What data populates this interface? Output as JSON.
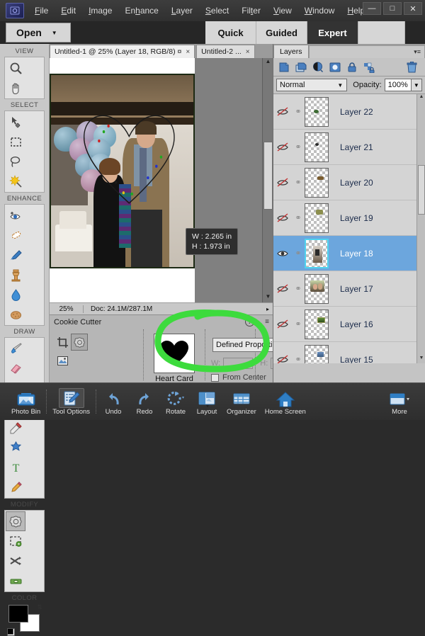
{
  "app": {
    "logo_icon": "photoshop-elements-logo-icon",
    "menu": [
      {
        "label": "File",
        "accel": "F"
      },
      {
        "label": "Edit",
        "accel": "E"
      },
      {
        "label": "Image",
        "accel": "I"
      },
      {
        "label": "Enhance",
        "accel": "h"
      },
      {
        "label": "Layer",
        "accel": "L"
      },
      {
        "label": "Select",
        "accel": "S"
      },
      {
        "label": "Filter",
        "accel": "t"
      },
      {
        "label": "View",
        "accel": "V"
      },
      {
        "label": "Window",
        "accel": "W"
      },
      {
        "label": "Help",
        "accel": "H"
      }
    ],
    "window_controls": [
      {
        "name": "minimize",
        "glyph": "—"
      },
      {
        "name": "maximize",
        "glyph": "□"
      },
      {
        "name": "close",
        "glyph": "✕"
      }
    ]
  },
  "modebar": {
    "open_label": "Open",
    "open_caret": "▼",
    "tabs": [
      {
        "label": "Quick",
        "active": false
      },
      {
        "label": "Guided",
        "active": false
      },
      {
        "label": "Expert",
        "active": true
      }
    ]
  },
  "toolbox": {
    "groups": [
      {
        "title": "VIEW",
        "tools": [
          {
            "name": "zoom-tool",
            "icon": "magnifier-icon",
            "selected": false
          },
          {
            "name": "hand-tool",
            "icon": "hand-icon",
            "selected": false
          }
        ]
      },
      {
        "title": "SELECT",
        "tools": [
          {
            "name": "move-tool",
            "icon": "move-arrow-icon",
            "selected": false
          },
          {
            "name": "marquee-tool",
            "icon": "rectangular-marquee-icon",
            "selected": false
          },
          {
            "name": "lasso-tool",
            "icon": "lasso-icon",
            "selected": false
          },
          {
            "name": "quick-selection-tool",
            "icon": "magic-wand-icon",
            "selected": false
          }
        ]
      },
      {
        "title": "ENHANCE",
        "tools": [
          {
            "name": "red-eye-tool",
            "icon": "eye-plus-icon",
            "selected": false
          },
          {
            "name": "spot-healing-tool",
            "icon": "healing-bandage-icon",
            "selected": false
          },
          {
            "name": "smart-brush-tool",
            "icon": "smart-brush-icon",
            "selected": false
          },
          {
            "name": "clone-stamp-tool",
            "icon": "clone-stamp-icon",
            "selected": false
          },
          {
            "name": "blur-tool",
            "icon": "water-drop-icon",
            "selected": false
          },
          {
            "name": "sponge-tool",
            "icon": "sponge-icon",
            "selected": false
          }
        ]
      },
      {
        "title": "DRAW",
        "tools": [
          {
            "name": "brush-tool",
            "icon": "paintbrush-icon",
            "selected": false
          },
          {
            "name": "eraser-tool",
            "icon": "eraser-icon",
            "selected": false
          },
          {
            "name": "paint-bucket-tool",
            "icon": "paint-bucket-icon",
            "selected": false
          },
          {
            "name": "gradient-tool",
            "icon": "gradient-icon",
            "selected": false
          },
          {
            "name": "color-picker-tool",
            "icon": "eyedropper-icon",
            "selected": false
          },
          {
            "name": "custom-shape-tool",
            "icon": "blue-shape-icon",
            "selected": false
          },
          {
            "name": "type-tool",
            "icon": "letter-t-icon",
            "selected": false
          },
          {
            "name": "pencil-tool",
            "icon": "pencil-icon",
            "selected": false
          }
        ]
      },
      {
        "title": "MODIFY",
        "tools": [
          {
            "name": "cookie-cutter-tool",
            "icon": "flower-cookie-cutter-icon",
            "selected": true
          },
          {
            "name": "recompose-tool",
            "icon": "recompose-icon",
            "selected": false
          },
          {
            "name": "content-aware-move-tool",
            "icon": "scissors-move-icon",
            "selected": false
          },
          {
            "name": "straighten-tool",
            "icon": "straighten-level-icon",
            "selected": false
          }
        ]
      },
      {
        "title": "COLOR",
        "tools": []
      }
    ],
    "color": {
      "foreground": "#000000",
      "background": "#ffffff",
      "swap_icon": "swap-colors-icon",
      "default_icon": "default-colors-icon"
    }
  },
  "document_tabs": [
    {
      "label": "Untitled-1 @ 25% (Layer 18, RGB/8) ¤",
      "active": true,
      "close": "×"
    },
    {
      "label": "Untitled-2 ...",
      "active": false,
      "close": "×"
    }
  ],
  "canvas": {
    "tooltip": {
      "width_line": "W : 2.265 in",
      "height_line": "H : 1.973 in"
    },
    "selection_shape": "heart-cookie-cutter-outline",
    "photo_description": "wedding photo of couple with balloons and cake"
  },
  "statusbar": {
    "zoom": "25%",
    "doc": "Doc: 24.1M/287.1M",
    "more_caret": "▸"
  },
  "tool_options": {
    "title": "Cookie Cutter",
    "help_glyph": "?",
    "panel_menu_glyph": "≡",
    "mini_tools": [
      {
        "name": "crop-tool",
        "icon": "crop-icon",
        "selected": false
      },
      {
        "name": "cookie-cutter-tool",
        "icon": "flower-cookie-cutter-icon",
        "selected": true
      },
      {
        "name": "photo-merge-tool",
        "icon": "photo-frame-icon",
        "selected": false
      }
    ],
    "shape": {
      "name": "Heart Card",
      "icon": "heart-icon"
    },
    "crop_mode": {
      "value": "Defined Proportions",
      "caret": "▼"
    },
    "width_label": "W:",
    "width_value": "",
    "height_label": "H:",
    "height_value": "",
    "from_center_label": "From Center",
    "from_center_checked": false
  },
  "annotation": {
    "shape": "green-ellipse-highlight",
    "color": "#3ddb3d"
  },
  "layers_panel": {
    "tab_label": "Layers",
    "panel_menu_glyph": "▾≡",
    "tools": [
      {
        "name": "new-layer-button",
        "icon": "new-layer-icon"
      },
      {
        "name": "duplicate-layer-button",
        "icon": "duplicate-layer-icon"
      },
      {
        "name": "adjustment-layer-button",
        "icon": "adjustment-circle-icon"
      },
      {
        "name": "layer-mask-button",
        "icon": "layer-mask-icon"
      },
      {
        "name": "lock-all-button",
        "icon": "lock-icon"
      },
      {
        "name": "lock-transparency-button",
        "icon": "lock-transparency-icon"
      },
      {
        "name": "delete-layer-button",
        "icon": "trash-icon"
      }
    ],
    "blend_mode": {
      "value": "Normal",
      "caret": "▼"
    },
    "opacity_label": "Opacity:",
    "opacity_value": "100%",
    "opacity_caret": "▼",
    "layers": [
      {
        "name": "Layer 22",
        "visible": false,
        "selected": false,
        "thumb": "small-green-leaf"
      },
      {
        "name": "Layer 21",
        "visible": false,
        "selected": false,
        "thumb": "tiny-dark-speck"
      },
      {
        "name": "Layer 20",
        "visible": false,
        "selected": false,
        "thumb": "small-brown-object"
      },
      {
        "name": "Layer 19",
        "visible": false,
        "selected": false,
        "thumb": "small-olive-object"
      },
      {
        "name": "Layer 18",
        "visible": true,
        "selected": true,
        "thumb": "photo-fragment"
      },
      {
        "name": "Layer 17",
        "visible": false,
        "selected": false,
        "thumb": "couple-photo-fragment"
      },
      {
        "name": "Layer 16",
        "visible": false,
        "selected": false,
        "thumb": "green-photo-fragment"
      },
      {
        "name": "Layer 15",
        "visible": false,
        "selected": false,
        "thumb": "blue-photo-fragment"
      },
      {
        "name": "",
        "visible": false,
        "selected": false,
        "thumb": "partial-row"
      }
    ],
    "eye_visible_icon": "eye-icon",
    "eye_hidden_icon": "eye-slash-icon",
    "link_icon": "chain-link-icon"
  },
  "taskbar": {
    "items": [
      {
        "label": "Photo Bin",
        "icon": "photo-bin-icon",
        "selected": false
      },
      {
        "label": "Tool Options",
        "icon": "tool-options-icon",
        "selected": true
      },
      {
        "label": "Undo",
        "icon": "undo-arrow-icon",
        "selected": false
      },
      {
        "label": "Redo",
        "icon": "redo-arrow-icon",
        "selected": false
      },
      {
        "label": "Rotate",
        "icon": "rotate-icon",
        "selected": false
      },
      {
        "label": "Layout",
        "icon": "layout-grid-icon",
        "selected": false
      },
      {
        "label": "Organizer",
        "icon": "organizer-grid-icon",
        "selected": false
      },
      {
        "label": "Home Screen",
        "icon": "home-icon",
        "selected": false
      },
      {
        "label": "More",
        "icon": "more-panel-icon",
        "selected": false
      }
    ]
  }
}
